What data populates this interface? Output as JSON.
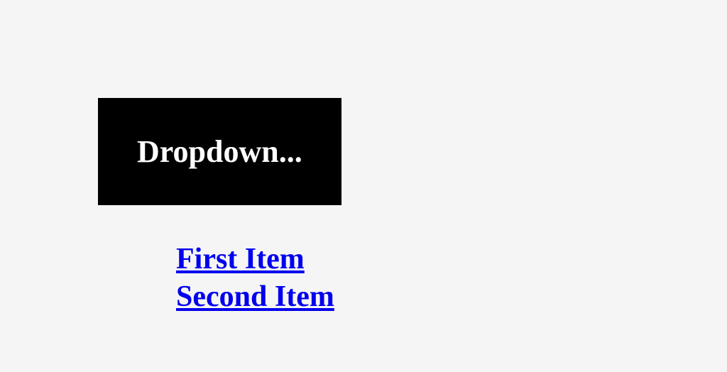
{
  "dropdown": {
    "button_label": "Dropdown...",
    "items": [
      {
        "label": "First Item"
      },
      {
        "label": "Second Item"
      }
    ]
  }
}
